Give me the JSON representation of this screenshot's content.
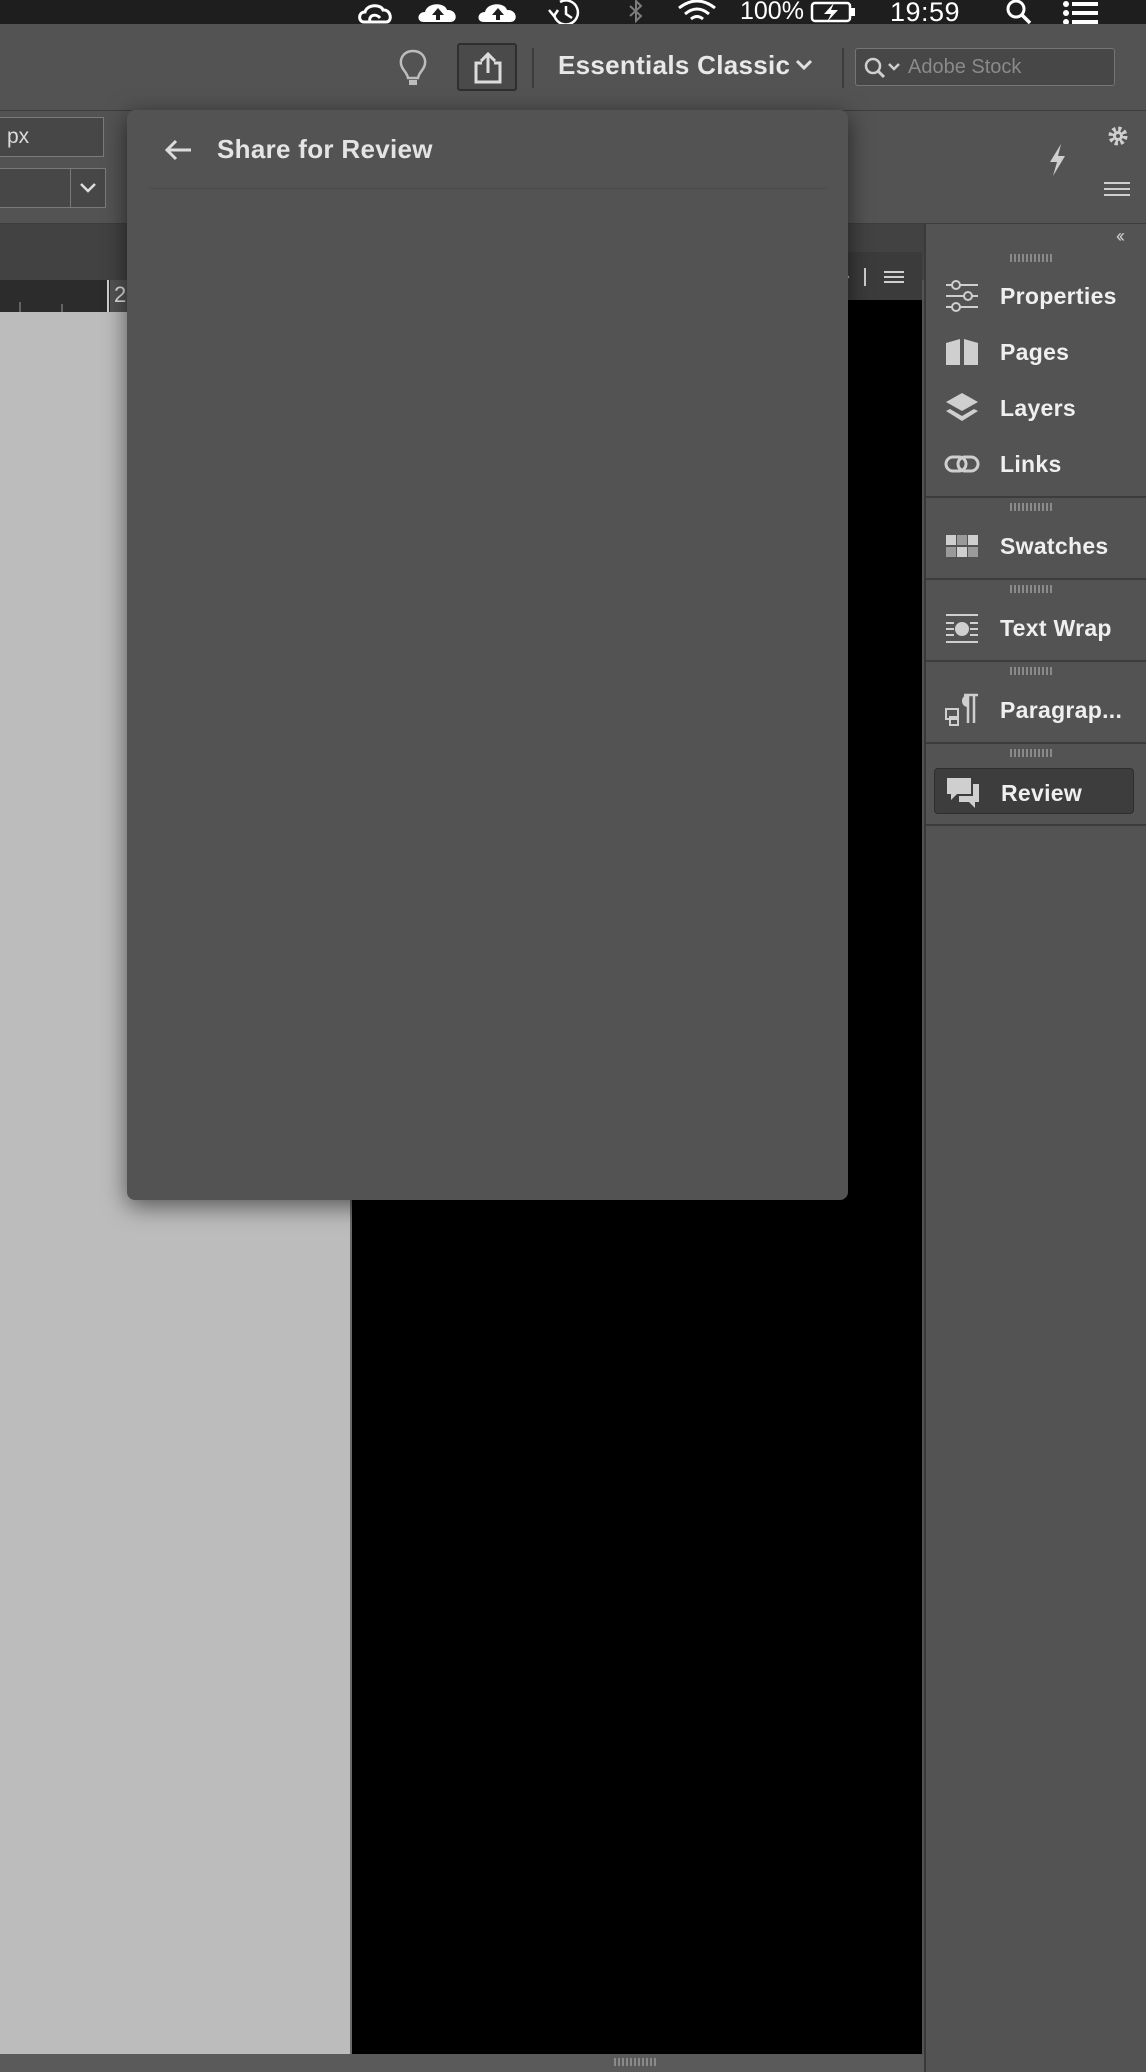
{
  "menubar": {
    "battery_pct": "100%",
    "clock": "19:59",
    "icons": [
      "creative-cloud-icon",
      "cloud-upload-icon",
      "cloud-upload-icon",
      "time-machine-icon",
      "bluetooth-icon",
      "wifi-icon",
      "battery-charging-icon",
      "spotlight-search-icon",
      "notification-center-icon"
    ]
  },
  "appbar": {
    "workspace": "Essentials Classic",
    "search_placeholder": "Adobe Stock",
    "icons": [
      "lightbulb-icon",
      "share-icon",
      "chevron-down-icon",
      "search-icon"
    ]
  },
  "control_panel": {
    "unit_value": "px",
    "icons": [
      "lightning-icon",
      "gear-icon",
      "panel-menu-icon",
      "chevron-down-icon"
    ]
  },
  "ruler": {
    "visible_number": "2"
  },
  "share_popup": {
    "title": "Share for Review",
    "back_icon": "arrow-left-icon"
  },
  "dock": {
    "collapse_label": "‹‹",
    "groups": [
      [
        {
          "label": "Properties",
          "icon": "properties-sliders-icon"
        },
        {
          "label": "Pages",
          "icon": "pages-icon"
        },
        {
          "label": "Layers",
          "icon": "layers-icon"
        },
        {
          "label": "Links",
          "icon": "links-icon"
        }
      ],
      [
        {
          "label": "Swatches",
          "icon": "swatches-icon"
        }
      ],
      [
        {
          "label": "Text Wrap",
          "icon": "text-wrap-icon"
        }
      ],
      [
        {
          "label": "Paragrap...",
          "icon": "paragraph-icon"
        }
      ],
      [
        {
          "label": "Review",
          "icon": "review-comment-icon",
          "active": true
        }
      ]
    ]
  },
  "colors": {
    "chrome": "#535353",
    "dark_chrome": "#424242",
    "pasteboard": "#bcbcbc",
    "page": "#000000",
    "active_item": "#3d3d3d"
  }
}
